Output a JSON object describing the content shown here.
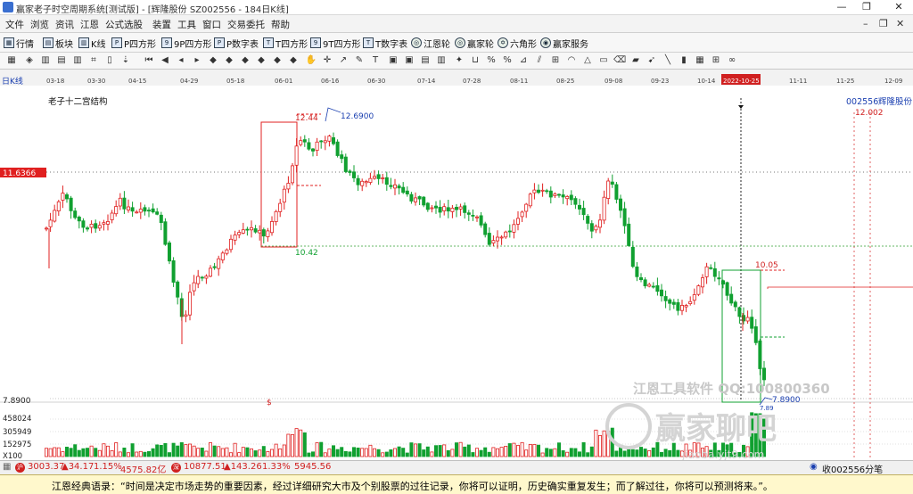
{
  "window": {
    "title": "赢家老子时空周期系统[测试版] - [辉隆股份 SZ002556 - 184日K线]",
    "minimize": "—",
    "maximize": "❐",
    "close": "✕"
  },
  "menu": [
    "文件",
    "浏览",
    "资讯",
    "江恩",
    "公式选股",
    "装置",
    "工具",
    "窗口",
    "交易委托",
    "帮助"
  ],
  "menu_right": [
    "–",
    "❐",
    "✕"
  ],
  "toolbar": [
    {
      "label": "行情",
      "icon": "grid-icon"
    },
    {
      "label": "板块",
      "icon": "blocks-icon"
    },
    {
      "label": "K线",
      "icon": "candle-icon"
    },
    {
      "label": "P四方形",
      "icon": "p-square-icon"
    },
    {
      "label": "9P四方形",
      "icon": "9p-square-icon"
    },
    {
      "label": "P数字表",
      "icon": "p-table-icon"
    },
    {
      "label": "T四方形",
      "icon": "t-square-icon"
    },
    {
      "label": "9T四方形",
      "icon": "9t-square-icon"
    },
    {
      "label": "T数字表",
      "icon": "t-table-icon"
    },
    {
      "label": "江恩轮",
      "icon": "gann-wheel-icon"
    },
    {
      "label": "赢家轮",
      "icon": "winner-wheel-icon"
    },
    {
      "label": "六角形",
      "icon": "hexagon-icon"
    },
    {
      "label": "赢家服务",
      "icon": "service-icon"
    }
  ],
  "chart": {
    "period_label": "日K线",
    "indicator_name": "老子十二宫结构",
    "stock_code": "002556",
    "stock_name": "辉隆股份",
    "right_value": "12.002",
    "dates": [
      "03-18",
      "03-30",
      "04-15",
      "04-29",
      "05-18",
      "06-01",
      "06-16",
      "06-30",
      "07-14",
      "07-28",
      "08-11",
      "08-25",
      "09-08",
      "09-23",
      "10-14",
      "2022-10-25",
      "11-11",
      "11-25",
      "12-09"
    ],
    "highlight_date": "2022-10-25",
    "left_price_label": "11.6366",
    "low_price_label": "7.8900",
    "dollar_marker": "$",
    "labels": {
      "box1_top": "12.44",
      "box1_peak": "12.6900",
      "box1_bottom": "10.42",
      "box2_top": "10.05",
      "box2_bottom": "7.8900",
      "box2_small": "7.89"
    },
    "volume_ticks": [
      "458024",
      "305949",
      "152975",
      "X100"
    ],
    "watermark1": "江恩工具软件  QQ:100800360",
    "watermark2": "赢家聊吧",
    "watermark3": "jiaoba.yjt9.com",
    "colors": {
      "up": "#e02020",
      "down": "#10a030",
      "box1": "#e02020",
      "box2": "#10a030"
    }
  },
  "status": {
    "index1_value": "3003.37",
    "index1_change": "▲34.17",
    "index1_pct": "1.15%",
    "index1_amount": "4575.82亿",
    "index2_value": "10877.51",
    "index2_change": "▲143.26",
    "index2_pct": "1.33%",
    "index2_amount": "5945.56",
    "right_text": "收002556分笔"
  },
  "quote": "江恩经典语录：“时间是决定市场走势的重要因素，经过详细研究大市及个别股票的过往记录，你将可以证明，历史确实重复发生；而了解过往，你将可以预测将来。”。"
}
